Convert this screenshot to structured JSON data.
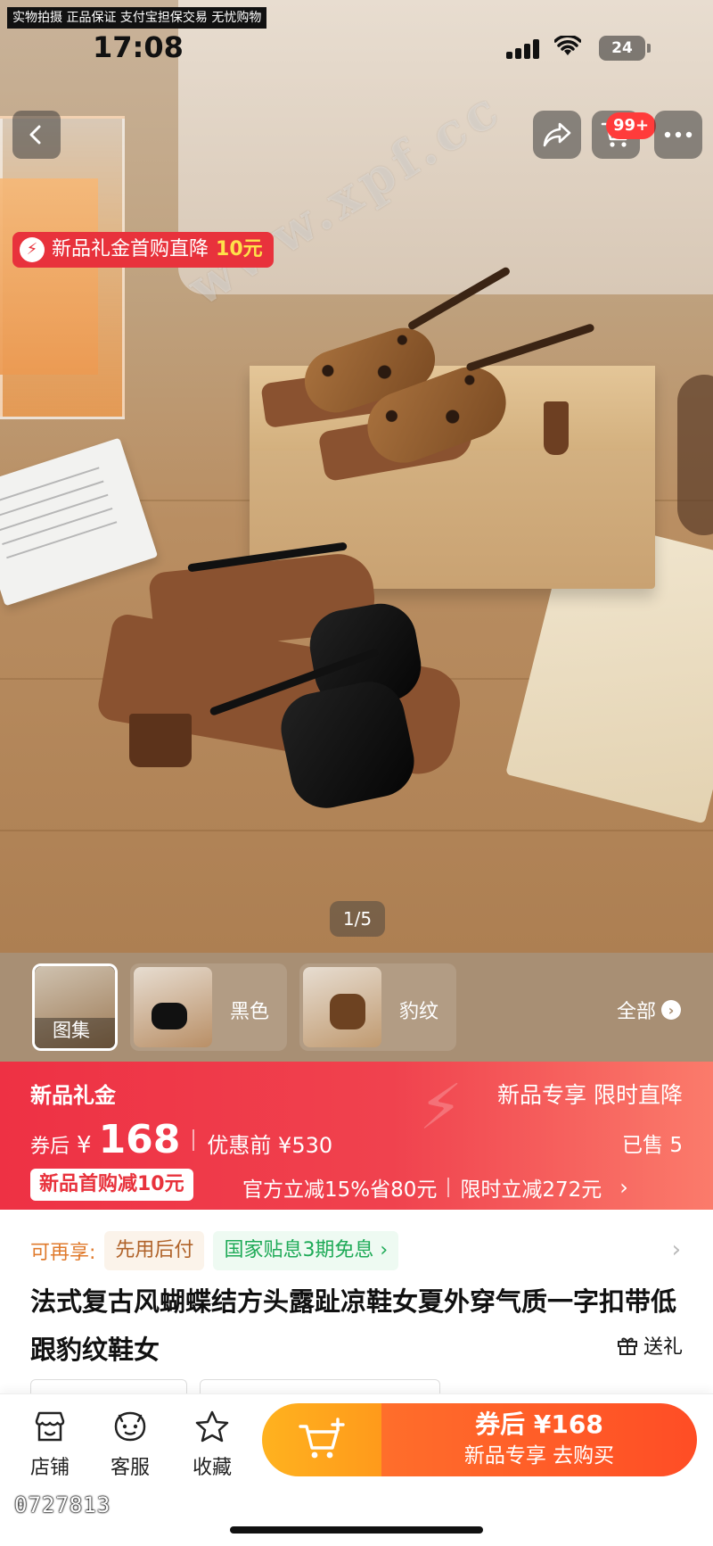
{
  "top_strip": "实物拍摄  正品保证  支付宝担保交易  无忧购物",
  "status": {
    "time": "17:08",
    "battery": "24"
  },
  "header": {
    "cart_badge": "99+"
  },
  "promo_tag": {
    "text": "新品礼金首购直降",
    "amount": "10元"
  },
  "watermark": "www.xpf.cc",
  "image_counter": "1/5",
  "thumbnails": [
    {
      "label": "图集"
    },
    {
      "label": "黑色"
    },
    {
      "label": "豹纹"
    }
  ],
  "thumbnails_all": "全部",
  "price": {
    "label": "新品礼金",
    "right_label": "新品专享 限时直降",
    "coupon_label": "券后",
    "currency": "¥",
    "value": "168",
    "original_label": "优惠前 ¥530",
    "sold": "已售 5",
    "pill": "新品首购减10元",
    "promo_1": "官方立减15%省80元",
    "promo_2": "限时立减272元"
  },
  "benefits": {
    "label": "可再享:",
    "chip_1": "先用后付",
    "chip_2": "国家贴息3期免息 ›"
  },
  "product_title": "法式复古风蝴蝶结方头露趾凉鞋女夏外穿气质一字扣带低跟豹纹鞋女",
  "gift_label": "送礼",
  "bottom_nav": [
    {
      "label": "店铺",
      "icon": "store-icon"
    },
    {
      "label": "客服",
      "icon": "customer-service-icon"
    },
    {
      "label": "收藏",
      "icon": "star-icon"
    }
  ],
  "buy_button": {
    "top": "券后 ¥168",
    "sub": "新品专享  去购买"
  },
  "bottom_code": "0727813",
  "colors": {
    "accent": "#e8323c",
    "buy_orange": "#ff5a28",
    "cart_yellow": "#ffa81e"
  }
}
